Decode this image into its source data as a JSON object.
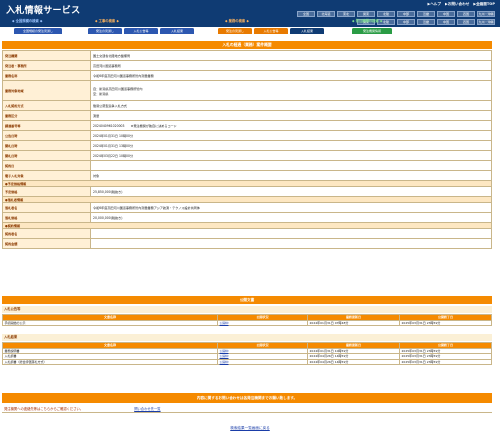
{
  "header": {
    "title": "入札情報サービス",
    "links": [
      "▶ヘルプ",
      "▶お問い合わせ",
      "▶全画面TOP"
    ],
    "regions_top": [
      "全国",
      "北海道",
      "東北",
      "関東",
      "北陸",
      "中部",
      "近畿",
      "中国",
      "四国",
      "九州・沖縄"
    ],
    "regions_bottom": [
      "関東",
      "北陸",
      "中部",
      "近畿",
      "中国",
      "四国",
      "九州・沖縄"
    ]
  },
  "sections": {
    "current": "◆ 工事の検索 ◆",
    "works": "◆ 業務の検索 ◆",
    "facilities": "◆ 発注機関の検索 ◆",
    "left_label": "◆ 全国規模の検索 ◆"
  },
  "tabs": [
    {
      "label": "全国規模の発注見通し",
      "color": "blue"
    },
    {
      "label": "発注の見通し",
      "color": "blue"
    },
    {
      "label": "入札公告等",
      "color": "blue"
    },
    {
      "label": "入札結果",
      "color": "blue"
    },
    {
      "label": "発注の見通し",
      "color": "orange"
    },
    {
      "label": "入札公告等",
      "color": "orange"
    },
    {
      "label": "入札結果",
      "color": "navy"
    },
    {
      "label": "発注機関情報",
      "color": "green"
    }
  ],
  "detail": {
    "title": "入札の経過（業務）案件概要",
    "rows": [
      {
        "k": "発注機関",
        "v": "国土交通省北陸地方整備局"
      },
      {
        "k": "発注者・事務所",
        "v": "高田河川国道事務所"
      },
      {
        "k": "業務名称",
        "v": "令和6年度高田河川国道事務所管内測量業務"
      },
      {
        "k": "業務対象地域",
        "v": "自：新潟県高田河川国道事務所管内\n至：新潟県"
      },
      {
        "k": "入札契約方式",
        "v": "簡易公募型競争入札方式"
      },
      {
        "k": "業務区分",
        "v": "測量"
      },
      {
        "k": "調達番号等",
        "v": "2024040961020003　　★発注機関が独自に決めるコード"
      },
      {
        "k": "公告日時",
        "v": "2024年01月31日 10時00分"
      },
      {
        "k": "開札日時",
        "v": "2024年01月31日 13時00分"
      },
      {
        "k": "開札日時",
        "v": "2024年03月22日 10時00分"
      },
      {
        "k": "契約日",
        "v": ""
      },
      {
        "k": "電子入札対象",
        "v": "対象"
      }
    ],
    "group_amount": "●予定価格情報",
    "amount_rows": [
      {
        "k": "予定価格",
        "v": "25,850,000(税抜き)"
      }
    ],
    "group_winner": "●落札者情報",
    "winner_rows": [
      {
        "k": "落札者名",
        "v": "令和6年度高田河川国道事務所管内測量業務アジア航測・テクノス設計共同体"
      },
      {
        "k": "落札価格",
        "v": "20,000,000(税抜き)"
      }
    ],
    "group_contract": "●契約情報",
    "contract_rows": [
      {
        "k": "契約者名",
        "v": ""
      },
      {
        "k": "契約金額",
        "v": ""
      }
    ]
  },
  "publications": {
    "title": "公開文書",
    "bid_notice_group": "入札公告等",
    "bid_notice_headers": [
      "文書名称",
      "公開状況",
      "最終更新日",
      "公開終了日"
    ],
    "bid_notice_rows": [
      [
        "手続開始の公示",
        "公開中",
        "2024年01月31日 07時48分",
        "2025年03月31日 23時59分"
      ]
    ],
    "result_group": "入札結果",
    "result_headers": [
      "文書名称",
      "公開状況",
      "最終更新日",
      "公開終了日"
    ],
    "result_rows": [
      [
        "業務説明書",
        "公開中",
        "2024年01月31日 10時59分",
        "2025年03月31日 23時59分"
      ],
      [
        "入札調書",
        "公開中",
        "2024年04月26日 14時59分",
        "2025年03月31日 23時59分"
      ],
      [
        "入札調書（総合評価落札方式）",
        "公開中",
        "2024年04月26日 14時59分",
        "2025年03月31日 23時59分"
      ]
    ]
  },
  "contact": {
    "title": "内容に関するお問い合わせは各発注機関までお願い致します。",
    "row_label": "発注機関への連絡先等はこちらからご確認ください。",
    "row_link": "問い合わせ先一覧"
  },
  "back_link": "検索結果一覧画面に戻る"
}
